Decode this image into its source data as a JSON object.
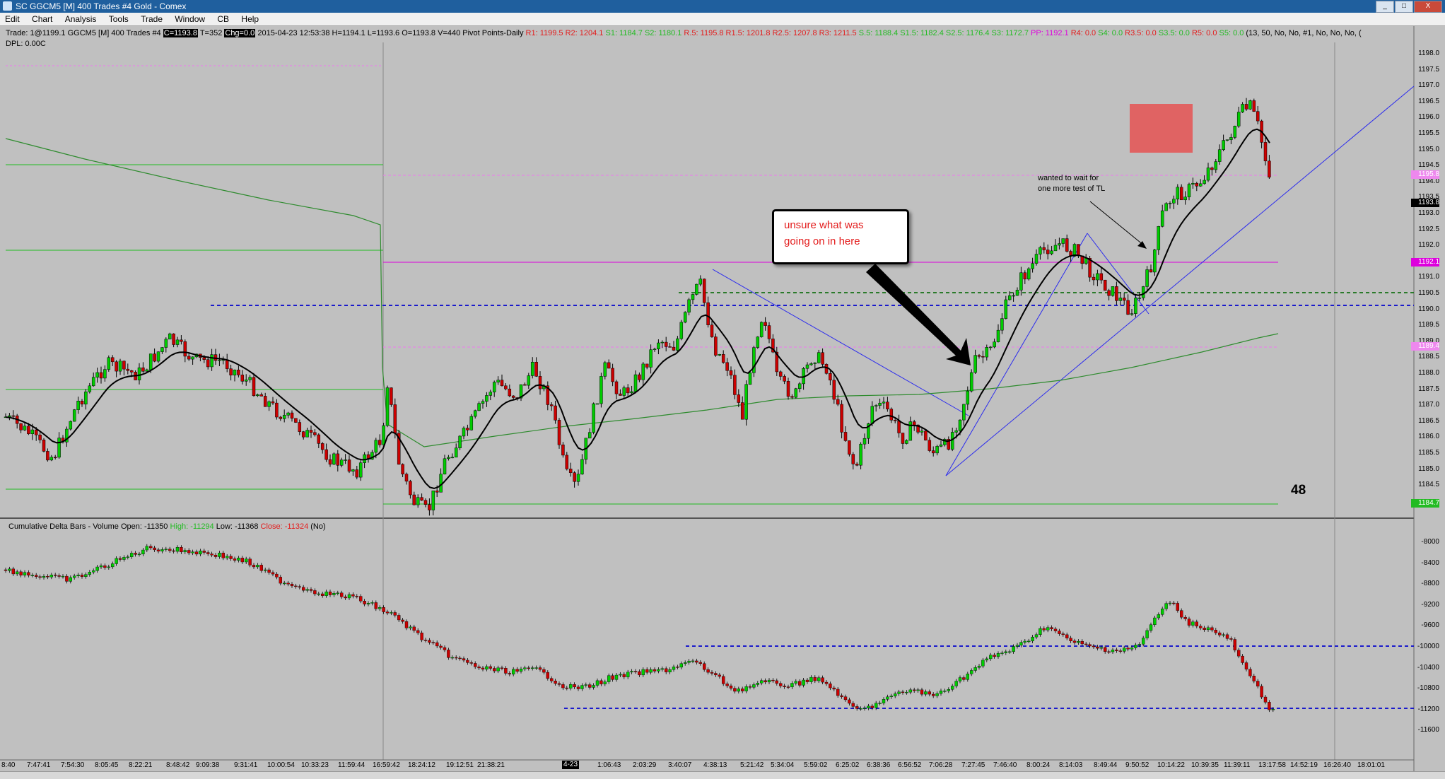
{
  "window": {
    "title": "SC GGCM5 [M]  400 Trades  #4  Gold - Comex",
    "controls": [
      "_",
      "□",
      "X"
    ]
  },
  "menu": [
    "Edit",
    "Chart",
    "Analysis",
    "Tools",
    "Trade",
    "Window",
    "CB",
    "Help"
  ],
  "infobar": {
    "trade": "Trade: 1@1199.1",
    "symbol": "GGCM5 [M]  400 Trades  #4",
    "close": "C=1193.8",
    "ticks": "T=352",
    "chg": "Chg=0.0",
    "bar": "2015-04-23 12:53:38 H=1194.1 L=1193.6 O=1193.8 V=440 Pivot Points-Daily",
    "r1": "R1: 1199.5",
    "r2": "R2: 1204.1",
    "s1": "S1: 1184.7",
    "s2": "S2: 1180.1",
    "r05": "R.5: 1195.8",
    "r15": "R1.5: 1201.8",
    "r25": "R2.5: 1207.8",
    "r3": "R3: 1211.5",
    "s05": "S.5: 1188.4",
    "s15": "S1.5: 1182.4",
    "s25": "S2.5: 1176.4",
    "s3": "S3: 1172.7",
    "pp": "PP: 1192.1",
    "r4": "R4: 0.0",
    "s4": "S4: 0.0",
    "r35": "R3.5: 0.0",
    "s35": "S3.5: 0.0",
    "r5": "R5: 0.0",
    "s5": "S5: 0.0",
    "params": "(13, 50, No, No, #1, No, No, No, ("
  },
  "dpl": "DPL: 0.00C",
  "lower_title": {
    "name": "Cumulative Delta Bars - Volume",
    "open": "Open: -11350",
    "high": "High: -11294",
    "low": "Low: -11368",
    "close": "Close: -11324",
    "no": "(No)"
  },
  "annotations": {
    "callout_line1": "unsure what was",
    "callout_line2": "going on in here",
    "note_line1": "wanted to wait for",
    "note_line2": "one more test of  TL",
    "number": "48"
  },
  "price_axis": [
    "1198.0",
    "1197.5",
    "1197.0",
    "1196.5",
    "1196.0",
    "1195.5",
    "1195.0",
    "1194.5",
    "1194.0",
    "1193.5",
    "1193.0",
    "1192.5",
    "1192.0",
    "1191.5",
    "1191.0",
    "1190.5",
    "1190.0",
    "1189.5",
    "1189.0",
    "1188.5",
    "1188.0",
    "1187.5",
    "1187.0",
    "1186.5",
    "1186.0",
    "1185.5",
    "1185.0",
    "1184.5"
  ],
  "price_tags": {
    "last": "1193.8",
    "pp": "1192.1",
    "s05": "1189.4",
    "r05": "1195.8",
    "s1": "1184.7"
  },
  "delta_axis": [
    "-8000",
    "-8400",
    "-8800",
    "-9200",
    "-9600",
    "-10000",
    "-10400",
    "-10800",
    "-11200",
    "-11600"
  ],
  "time_axis": [
    "8:40",
    "7:47:41",
    "7:54:30",
    "8:05:45",
    "8:22:21",
    "8:48:42",
    "9:09:38",
    "9:31:41",
    "10:00:54",
    "10:33:23",
    "11:59:44",
    "16:59:42",
    "18:24:12",
    "19:12:51",
    "21:38:21",
    "4-23",
    "1:06:43",
    "2:03:29",
    "3:40:07",
    "4:38:13",
    "5:21:42",
    "5:34:04",
    "5:59:02",
    "6:25:02",
    "6:38:36",
    "6:56:52",
    "7:06:28",
    "7:27:45",
    "7:46:40",
    "8:00:24",
    "8:14:03",
    "8:49:44",
    "9:50:52",
    "10:14:22",
    "10:39:35",
    "11:39:11",
    "13:17:58",
    "14:52:19",
    "16:26:40",
    "18:01:01"
  ],
  "colors": {
    "up": "#00cc00",
    "down": "#cc0000",
    "ma_fast": "#000000",
    "ma_slow": "#2e8b2e",
    "pivot": "#dd00dd",
    "support": "#22bb22",
    "trendline": "#2222ee"
  }
}
